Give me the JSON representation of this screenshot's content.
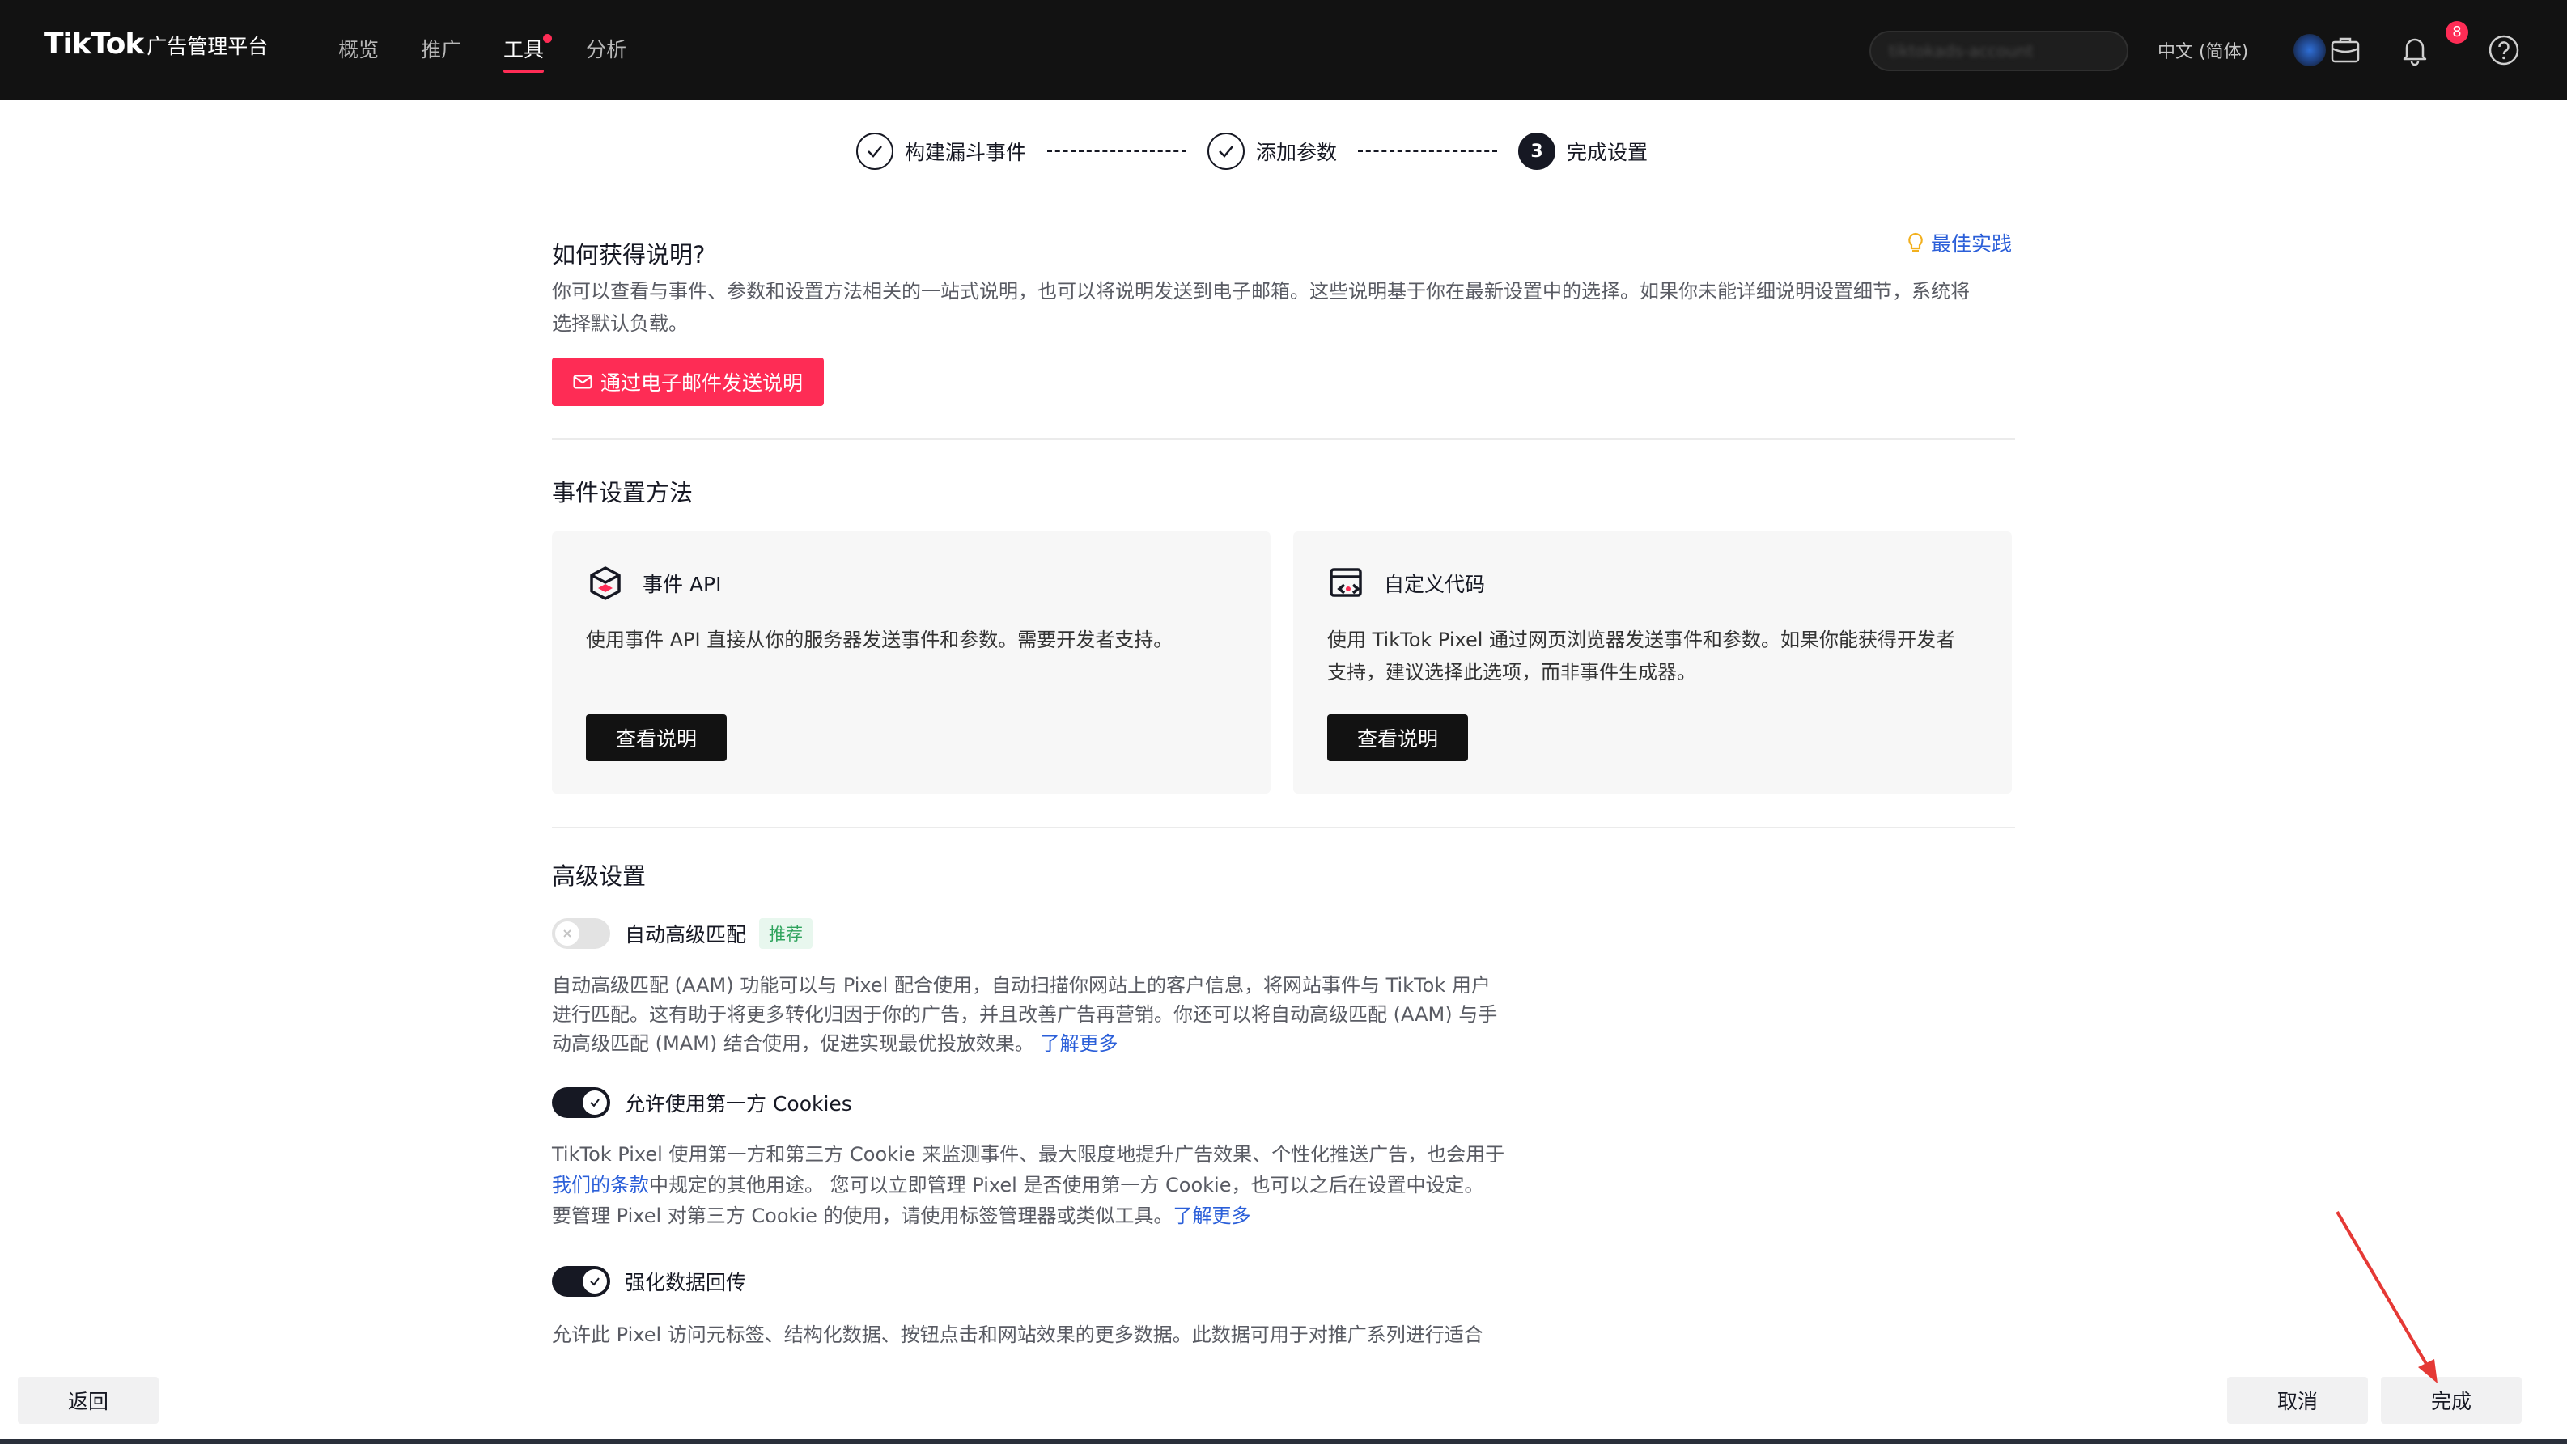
{
  "header": {
    "logo_main": "TikTok",
    "logo_sub": "广告管理平台",
    "nav": [
      "概览",
      "推广",
      "工具",
      "分析"
    ],
    "active_nav_index": 2,
    "account_name": "tiktokads-account",
    "language": "中文 (简体)",
    "notification_count": "8",
    "icons": [
      "avatar",
      "briefcase-icon",
      "bell-icon",
      "help-icon"
    ]
  },
  "steps": [
    {
      "label": "构建漏斗事件",
      "state": "done"
    },
    {
      "label": "添加参数",
      "state": "done"
    },
    {
      "label": "完成设置",
      "state": "current",
      "number": "3"
    }
  ],
  "instructions": {
    "title": "如何获得说明?",
    "best_practice": "最佳实践",
    "desc_line1": "你可以查看与事件、参数和设置方法相关的一站式说明，也可以将说明发送到电子邮箱。这些说明基于你在最新设置中的选择。如果你未能详细说明设置细节，系统将",
    "desc_line2": "选择默认负载。",
    "email_button": "通过电子邮件发送说明"
  },
  "methods": {
    "title": "事件设置方法",
    "items": [
      {
        "name": "事件 API",
        "desc": "使用事件 API 直接从你的服务器发送事件和参数。需要开发者支持。",
        "button": "查看说明"
      },
      {
        "name": "自定义代码",
        "desc": "使用 TikTok Pixel 通过网页浏览器发送事件和参数。如果你能获得开发者支持，建议选择此选项，而非事件生成器。",
        "button": "查看说明"
      }
    ]
  },
  "advanced": {
    "title": "高级设置",
    "aam": {
      "label": "自动高级匹配",
      "tag": "推荐",
      "enabled": false,
      "line1": "自动高级匹配 (AAM) 功能可以与 Pixel 配合使用，自动扫描你网站上的客户信息，将网站事件与 TikTok 用户",
      "line2": "进行匹配。这有助于将更多转化归因于你的广告，并且改善广告再营销。你还可以将自动高级匹配 (AAM) 与手",
      "line3": "动高级匹配 (MAM) 结合使用，促进实现最优投放效果。",
      "link": "了解更多"
    },
    "cookies": {
      "label": "允许使用第一方 Cookies",
      "enabled": true,
      "line1": "TikTok Pixel 使用第一方和第三方 Cookie 来监测事件、最大限度地提升广告效果、个性化推送广告，也会用于",
      "terms_link": "我们的条款",
      "line2_rest": "中规定的其他用途。 您可以立即管理 Pixel 是否使用第一方 Cookie，也可以之后在设置中设定。",
      "line3": "要管理 Pixel 对第三方 Cookie 的使用，请使用标签管理器或类似工具。",
      "link": "了解更多"
    },
    "enhanced": {
      "label": "强化数据回传",
      "enabled": true,
      "line1": "允许此 Pixel 访问元标签、结构化数据、按钮点击和网站效果的更多数据。此数据可用于对推广系列进行适合"
    }
  },
  "footer": {
    "back": "返回",
    "cancel": "取消",
    "done": "完成"
  },
  "colors": {
    "primary": "#fe2c55",
    "dark": "#121212",
    "link": "#2b5fd9",
    "annotation_arrow": "#e53935"
  }
}
